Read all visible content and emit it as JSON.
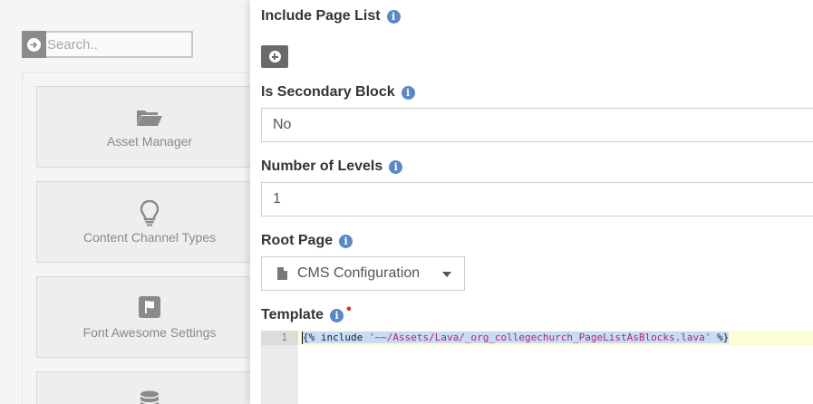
{
  "sidebar": {
    "search": {
      "placeholder": "Search..",
      "value": ""
    },
    "tiles": [
      {
        "label": "Asset Manager",
        "icon": "folder-open-icon"
      },
      {
        "label": "Content Channel Types",
        "icon": "lightbulb-icon"
      },
      {
        "label": "Font Awesome Settings",
        "icon": "flag-icon"
      },
      {
        "label": "",
        "icon": "database-icon"
      }
    ]
  },
  "settings": {
    "include_page_list": {
      "label": "Include Page List"
    },
    "is_secondary_block": {
      "label": "Is Secondary Block",
      "value": "No"
    },
    "number_of_levels": {
      "label": "Number of Levels",
      "value": "1"
    },
    "root_page": {
      "label": "Root Page",
      "value": "CMS Configuration"
    },
    "template": {
      "label": "Template",
      "required_mark": "•",
      "line_number": "1",
      "code_open": "{% include ",
      "code_string": "'~~/Assets/Lava/_org_collegechurch_PageListAsBlocks.lava'",
      "code_close": " %}"
    }
  },
  "colors": {
    "info_icon": "#5a88c6",
    "required": "#d9272e",
    "code_selection": "#c9dcf5",
    "active_line": "#fcfcd6"
  }
}
